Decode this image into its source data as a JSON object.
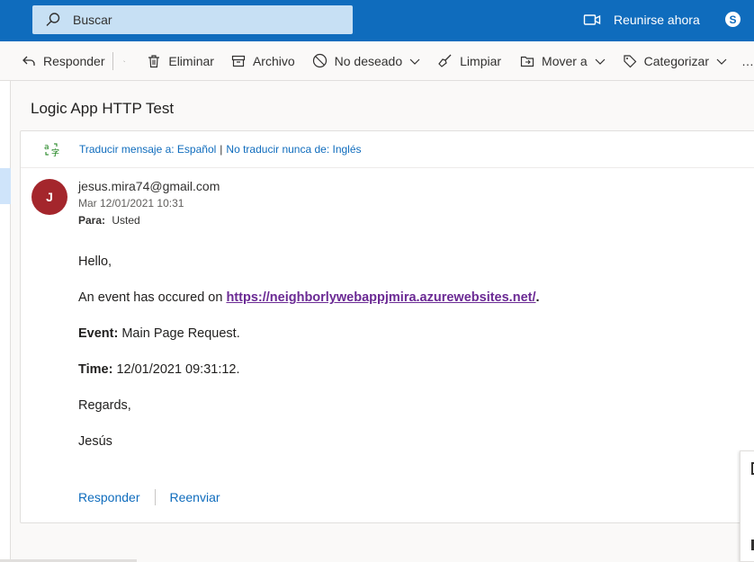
{
  "colors": {
    "header": "#0f6cbd",
    "accent": "#0f6cbd",
    "avatar": "#a4262c",
    "link": "#6b2a94"
  },
  "header": {
    "search_placeholder": "Buscar",
    "meet_label": "Reunirse ahora",
    "skype_icon": "S"
  },
  "toolbar": {
    "reply": "Responder",
    "delete": "Eliminar",
    "archive": "Archivo",
    "junk": "No deseado",
    "sweep": "Limpiar",
    "move": "Mover a",
    "categorize": "Categorizar",
    "more": "…"
  },
  "message": {
    "subject": "Logic App HTTP Test",
    "translate_to": "Traducir mensaje a: Español",
    "translate_sep": "|",
    "never_translate": "No traducir nunca de: Inglés",
    "avatar_initial": "J",
    "from": "jesus.mira74@gmail.com",
    "date": "Mar 12/01/2021 10:31",
    "to_label": "Para:",
    "to_value": "Usted",
    "greeting": "Hello,",
    "event_intro": "An event has occured on ",
    "event_link": "https://neighborlywebappjmira.azurewebsites.net/",
    "event_link_end": ".",
    "event_label": "Event:",
    "event_value": " Main Page Request.",
    "time_label": "Time:",
    "time_value": " 12/01/2021 09:31:12.",
    "regards": "Regards,",
    "signature": "Jesús"
  },
  "actions": {
    "reply": "Responder",
    "forward": "Reenviar"
  }
}
